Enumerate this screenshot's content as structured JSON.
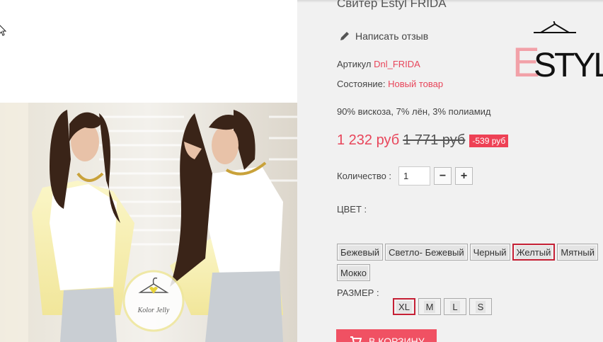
{
  "product": {
    "title": "Свитер Estyl FRIDA",
    "review_label": "Написать отзыв",
    "article_label": "Артикул",
    "article_value": "Dnl_FRIDA",
    "condition_label": "Состояние:",
    "condition_value": "Новый товар",
    "composition": "90% вискоза, 7% лён, 3% полиамид"
  },
  "brand_logo": {
    "letter": "E",
    "rest": "STYL"
  },
  "watermark": {
    "text": "Kolor Jelly"
  },
  "price": {
    "new": "1 232 руб",
    "old": "1 771 руб",
    "discount": "-539 руб"
  },
  "quantity": {
    "label": "Количество :",
    "value": "1",
    "minus": "−",
    "plus": "+"
  },
  "color": {
    "label": "ЦВЕТ :",
    "options": [
      "Бежевый",
      "Светло- Бежевый",
      "Черный",
      "Желтый",
      "Мятный",
      "Мокко"
    ],
    "selected": "Желтый"
  },
  "size": {
    "label": "РАЗМЕР :",
    "options": [
      "XL",
      "M",
      "L",
      "S"
    ],
    "selected": "XL"
  },
  "cart": {
    "label": "В КОРЗИНУ"
  },
  "colors": {
    "accent": "#e8455a",
    "selected_border": "#c52035",
    "panel_bg": "#f1f1f1"
  }
}
